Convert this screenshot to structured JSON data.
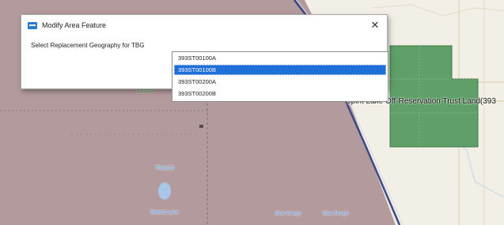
{
  "dialog": {
    "title": "Modify Area Feature",
    "close_glyph": "✕",
    "prompt_label": "Select Replacement Geography for TBG",
    "options": [
      "393ST00100A",
      "393ST00100B",
      "393ST00200A",
      "393ST00200B"
    ],
    "selected_option": "393ST00100B"
  },
  "map": {
    "labels": {
      "t00100_top": "T00100",
      "t00100_mid": "T00100",
      "wood_lake": "Wood Lake",
      "reservation": "Spirit Lake Off-Reservation Trust Land(393",
      "slough_1": "Blue Slough",
      "slough_2": "Blue Slough"
    }
  },
  "colors": {
    "map_background": "#f2efe6",
    "tract_area": "#b29a9d",
    "trust_land": "#5f9f68",
    "selection_blue": "#1f6fd8",
    "water": "#a9c6e8"
  }
}
